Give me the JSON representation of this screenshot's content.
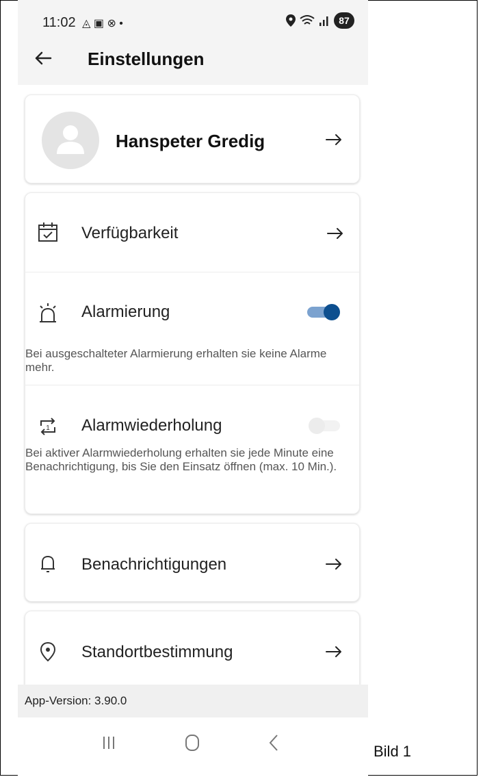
{
  "status_bar": {
    "time": "11:02",
    "battery": "87"
  },
  "header": {
    "title": "Einstellungen"
  },
  "profile": {
    "name": "Hanspeter Gredig"
  },
  "settings": {
    "availability": {
      "label": "Verfügbarkeit"
    },
    "alarming": {
      "label": "Alarmierung",
      "enabled": true,
      "description": "Bei ausgeschalteter Alarmierung erhalten sie keine Alarme mehr."
    },
    "alarm_repeat": {
      "label": "Alarmwiederholung",
      "enabled": false,
      "description": "Bei aktiver Alarmwiederholung erhalten sie jede Minute eine Benachrichtigung, bis Sie den Einsatz öffnen (max. 10 Min.)."
    },
    "notifications": {
      "label": "Benachrichtigungen"
    },
    "location": {
      "label": "Standortbestimmung"
    }
  },
  "footer": {
    "version": "App-Version: 3.90.0"
  },
  "caption": "Bild 1",
  "colors": {
    "accent": "#0d4f8f",
    "accent_track": "#7ba2cf",
    "off_thumb": "#ececec",
    "off_track": "#f2f2f2"
  }
}
